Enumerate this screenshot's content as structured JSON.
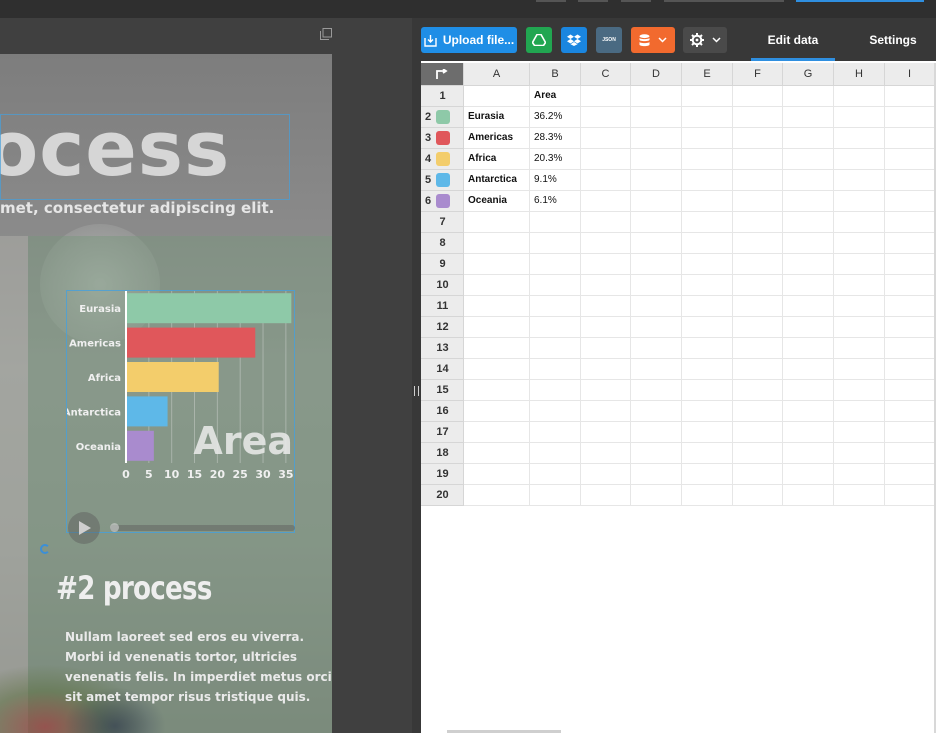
{
  "slide": {
    "title": "ocess",
    "subtitle": "met, consectetur adipiscing elit.",
    "section_heading": "#2 process",
    "body_lines": [
      "Nullam laoreet sed eros eu viverra.",
      "Morbi id venenatis tortor, ultricies",
      "venenatis felis. In imperdiet metus orci,",
      "sit amet tempor risus tristique quis."
    ]
  },
  "toolbar": {
    "upload_label": "Upload file...",
    "json_label": "JSON",
    "tabs": [
      {
        "label": "Edit data",
        "active": true
      },
      {
        "label": "Settings",
        "active": false
      }
    ]
  },
  "sheet": {
    "columns": [
      "A",
      "B",
      "C",
      "D",
      "E",
      "F",
      "G",
      "H",
      "I"
    ],
    "row_numbers": [
      "1",
      "2",
      "3",
      "4",
      "5",
      "6",
      "7",
      "8",
      "9",
      "10",
      "11",
      "12",
      "13",
      "14",
      "15",
      "16",
      "17",
      "18",
      "19",
      "20"
    ],
    "header_row": [
      "",
      "Area"
    ],
    "rows": [
      {
        "label": "Eurasia",
        "value": "36.2%",
        "color": "#8ec9a8"
      },
      {
        "label": "Americas",
        "value": "28.3%",
        "color": "#e0575b"
      },
      {
        "label": "Africa",
        "value": "20.3%",
        "color": "#f3cd6b"
      },
      {
        "label": "Antarctica",
        "value": "9.1%",
        "color": "#5eb8e8"
      },
      {
        "label": "Oceania",
        "value": "6.1%",
        "color": "#a98bce"
      }
    ]
  },
  "chart_data": {
    "type": "bar",
    "orientation": "horizontal",
    "categories": [
      "Eurasia",
      "Americas",
      "Africa",
      "Antarctica",
      "Oceania"
    ],
    "values": [
      36.2,
      28.3,
      20.3,
      9.1,
      6.1
    ],
    "colors": [
      "#8ec9a8",
      "#e0575b",
      "#f3cd6b",
      "#5eb8e8",
      "#a98bce"
    ],
    "xticks": [
      "0",
      "5",
      "10",
      "15",
      "20",
      "25",
      "30",
      "35"
    ],
    "xlim": [
      0,
      37
    ],
    "series_label": "Area",
    "grid": true
  }
}
